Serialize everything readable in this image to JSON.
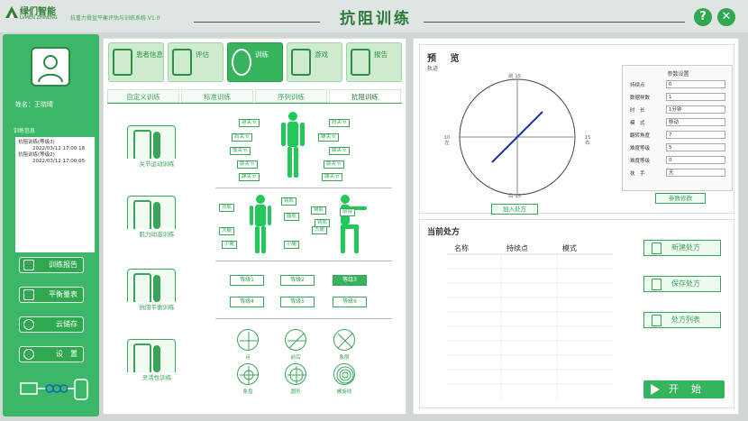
{
  "header": {
    "brand": "绿们智能",
    "brand_sub": "LVMEN ZHINENG",
    "system_name": "抗重力骨盆平衡评估与训练系统 V1.0",
    "title": "抗阻训练",
    "help_icon": "question-icon",
    "close_icon": "close-icon"
  },
  "sidebar": {
    "patient_name": "姓名：王晓晴",
    "history_label": "训练信息",
    "history_lines": [
      "抗阻训练(等级3)",
      "2022/03/12 17:00:18",
      "抗阻训练(等级2)",
      "2022/03/12 17:00:05"
    ],
    "buttons": [
      "训练报告",
      "平衡量表",
      "云储存",
      "设　置"
    ]
  },
  "nav": {
    "tiles": [
      "患者信息",
      "评估",
      "训练",
      "游戏",
      "报告"
    ],
    "active": "训练"
  },
  "tabs": [
    "自定义训练",
    "标准训练",
    "序列训练",
    "抗阻训练"
  ],
  "modes": [
    "关节运动训练",
    "肌力动态训练",
    "抗阻平衡训练",
    "灵活性训练"
  ],
  "joints": {
    "left": [
      "颈关节",
      "肩关节",
      "髋关节",
      "膝关节",
      "踝关节"
    ],
    "right": [
      "肩关节",
      "腰关节",
      "膝关节",
      "膝关节",
      "踝关节"
    ]
  },
  "muscles": [
    "背肌",
    "臂肌",
    "腹肌",
    "大腿",
    "小腿",
    "小腿",
    "臀肌",
    "臂肌",
    "大腿",
    "前臂"
  ],
  "levels": [
    "等级1",
    "等级2",
    "等级3",
    "等级4",
    "等级5",
    "等级6"
  ],
  "active_level": "等级3",
  "patterns": [
    "点",
    "前后",
    "象限",
    "象盘",
    "圆形",
    "螺旋线"
  ],
  "preview": {
    "title": "预 览",
    "subtitle": "轨迹",
    "dial_top": "前 15",
    "dial_bottom": "后 15",
    "dial_left": "10 左",
    "dial_right": "15 右",
    "add_button": "加入处方"
  },
  "params": {
    "header": "参数设置",
    "rows": [
      {
        "label": "持续点",
        "value": "0"
      },
      {
        "label": "数据样数",
        "value": "1"
      },
      {
        "label": "时　长",
        "value": "1分钟"
      },
      {
        "label": "模　式",
        "value": "移动"
      },
      {
        "label": "翻转角度",
        "value": "7"
      },
      {
        "label": "难度等级",
        "value": "5"
      },
      {
        "label": "难度等级",
        "value": "0"
      },
      {
        "label": "扶　手",
        "value": "无"
      }
    ],
    "modify_button": "参数修改"
  },
  "prescription": {
    "title": "当前处方",
    "columns": [
      "名称",
      "持续点",
      "模式"
    ],
    "buttons": [
      "新建处方",
      "保存处方",
      "处方列表"
    ],
    "start": "开始"
  }
}
